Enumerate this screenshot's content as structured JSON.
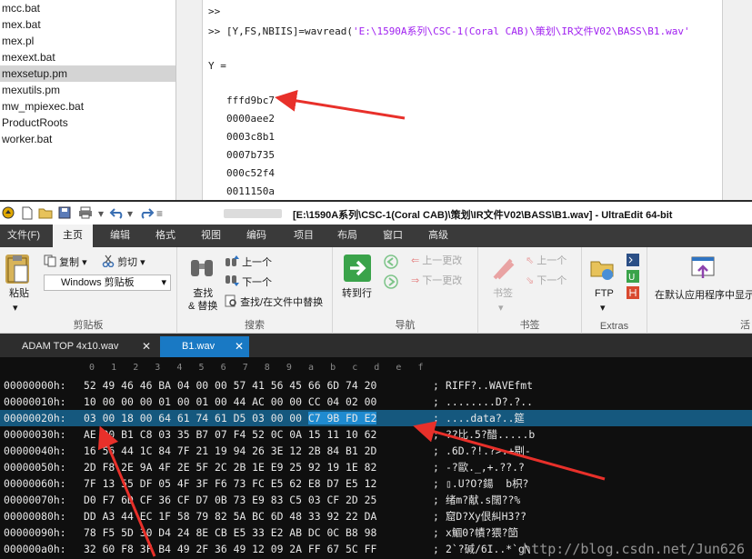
{
  "files": [
    "mcc.bat",
    "mex.bat",
    "mex.pl",
    "mexext.bat",
    "mexsetup.pm",
    "mexutils.pm",
    "mw_mpiexec.bat",
    "ProductRoots",
    "worker.bat"
  ],
  "selected_file_index": 4,
  "command_window": {
    "prompt1": ">>",
    "prompt2": ">> [Y,FS,NBIIS]=wavread(",
    "path_string": "'E:\\1590A系列\\CSC-1(Coral CAB)\\策划\\IR文件V02\\BASS\\B1.wav'",
    "var_line": "Y =",
    "values": [
      "fffd9bc7",
      "0000aee2",
      "0003c8b1",
      "0007b735",
      "000c52f4",
      "0011150a"
    ]
  },
  "ultraedit": {
    "title": "[E:\\1590A系列\\CSC-1(Coral CAB)\\策划\\IR文件V02\\BASS\\B1.wav] - UltraEdit 64-bit",
    "menu_tabs": [
      "文件(F)",
      "主页",
      "编辑",
      "格式",
      "视图",
      "编码",
      "项目",
      "布局",
      "窗口",
      "高级"
    ],
    "active_menu_tab": "主页",
    "ribbon": {
      "clipboard": {
        "paste": "粘贴",
        "copy": "复制",
        "cut": "剪切",
        "clipboard_combo": "Windows 剪贴板",
        "label": "剪贴板"
      },
      "search": {
        "find_replace": "查找\n& 替换",
        "find_up": "上一个",
        "find_down": "下一个",
        "find_in_files": "查找/在文件中替换",
        "label": "搜索"
      },
      "navigate": {
        "goto": "转到行",
        "prev_change": "上一更改",
        "next_change": "下一更改",
        "label": "导航"
      },
      "bookmarks": {
        "bookmark": "书签",
        "prev": "上一个",
        "next": "下一个",
        "label": "书签"
      },
      "extras": {
        "ftp": "FTP",
        "label": "Extras"
      },
      "open_default": "在默认应用程序中显示",
      "cut_label": "活"
    },
    "doc_tabs": [
      {
        "label": "ADAM TOP 4x10.wav",
        "active": false
      },
      {
        "label": "B1.wav",
        "active": true
      }
    ],
    "hex_ruler": [
      "0",
      "1",
      "2",
      "3",
      "4",
      "5",
      "6",
      "7",
      "8",
      "9",
      "a",
      "b",
      "c",
      "d",
      "e",
      "f"
    ],
    "hex_rows": [
      {
        "addr": "00000000h:",
        "bytes": "52 49 46 46 BA 04 00 00 57 41 56 45 66 6D 74 20",
        "ascii": "RIFF?..WAVEfmt"
      },
      {
        "addr": "00000010h:",
        "bytes": "10 00 00 00 01 00 01 00 44 AC 00 00 CC 04 02 00",
        "ascii": "........D?.?.."
      },
      {
        "addr": "00000020h:",
        "bytes": "03 00 18 00 64 61 74 61 D5 03 00 00 C7 9B FD E2",
        "ascii": "....data?..筵"
      },
      {
        "addr": "00000030h:",
        "bytes": "AE 00 B1 C8 03 35 B7 07 F4 52 0C 0A 15 11 10 62",
        "ascii": "??比.5?醋.....b"
      },
      {
        "addr": "00000040h:",
        "bytes": "16 56 44 1C 84 7F 21 19 94 26 3E 12 2B 84 B1 2D",
        "ascii": ".6D.?!.?>.+剔-"
      },
      {
        "addr": "00000050h:",
        "bytes": "2D F8 2E 9A 4F 2E 5F 2C 2B 1E E9 25 92 19 1E 82",
        "ascii": "-?歐._,+.??.?"
      },
      {
        "addr": "00000060h:",
        "bytes": "7F 13 55 DF 05 4F 3F F6 73 FC E5 62 E8 D7 E5 12",
        "ascii": "▯.U?O?鍚  b枳?"
      },
      {
        "addr": "00000070h:",
        "bytes": "D0 F7 6D CF 36 CF D7 0B 73 E9 83 C5 03 CF 2D 25",
        "ascii": "绪m?献.s闊??%"
      },
      {
        "addr": "00000080h:",
        "bytes": "DD A3 44 EC 1F 58 79 82 5A BC 6D 48 33 92 22 DA",
        "ascii": "窟D?Xy佷糾H3??"
      },
      {
        "addr": "00000090h:",
        "bytes": "78 F5 5D 30 D4 24 8E CB E5 33 E2 AB DC 0C B8 98",
        "ascii": "x鯝0?幘?猥?笝"
      },
      {
        "addr": "000000a0h:",
        "bytes": "32 60 F8 3F B4 49 2F 36 49 12 09 2A FF 67 5C FF",
        "ascii": "2`?碱/6I..*`g\\"
      }
    ],
    "highlight_row_index": 2,
    "highlight_bytes": "C7 9B FD E2",
    "watermark": "http://blog.csdn.net/Jun626"
  },
  "colors": {
    "arrow": "#e8302a",
    "selection": "#15587e",
    "tab_active": "#1979c4"
  }
}
